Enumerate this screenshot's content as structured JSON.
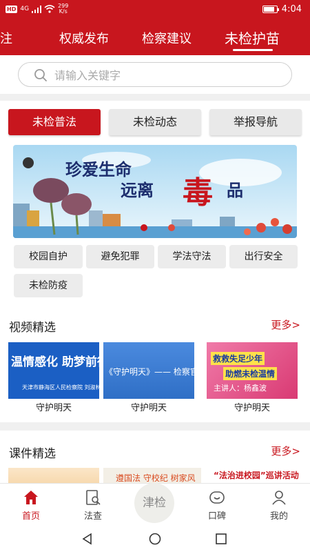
{
  "status_bar": {
    "badge": "HD",
    "net": "4G",
    "speed_value": "299",
    "speed_unit": "K/s",
    "time": "4:04",
    "battery_level": 0.85
  },
  "top_tabs": [
    {
      "label": "关注"
    },
    {
      "label": "权威发布"
    },
    {
      "label": "检察建议"
    },
    {
      "label": "未检护苗",
      "active": true
    }
  ],
  "search": {
    "placeholder": "请输入关键字"
  },
  "sub_tabs": [
    {
      "label": "未检普法",
      "active": true
    },
    {
      "label": "未检动态"
    },
    {
      "label": "举报导航"
    }
  ],
  "banner": {
    "line1": "珍爱生命",
    "line2_a": "远离",
    "line2_b": "毒",
    "line2_c": "品"
  },
  "categories": [
    "校园自护",
    "避免犯罪",
    "学法守法",
    "出行安全",
    "未检防疫"
  ],
  "video_section": {
    "title": "视频精选",
    "more": "更多>",
    "items": [
      {
        "caption": "守护明天",
        "thumb_line1": "温情感化 助梦前行",
        "thumb_line2": "天津市静海区人民检察院 刘淑林"
      },
      {
        "caption": "守护明天",
        "thumb_line1": "《守护明天》—— 检察官讲述"
      },
      {
        "caption": "守护明天",
        "thumb_line1": "救救失足少年",
        "thumb_line2": "助燃未检温情",
        "thumb_line3": "主讲人：杨鑫波"
      }
    ]
  },
  "course_section": {
    "title": "课件精选",
    "more": "更多>",
    "items": [
      {
        "text": ""
      },
      {
        "text": "遵国法 守校纪 树家风"
      },
      {
        "text": "“法治进校园”巡讲活动"
      }
    ]
  },
  "bottom_nav": [
    {
      "label": "首页",
      "icon": "home-icon",
      "active": true
    },
    {
      "label": "法查",
      "icon": "law-search-icon"
    },
    {
      "label": "口碑",
      "icon": "reputation-icon"
    },
    {
      "label": "我的",
      "icon": "profile-icon"
    }
  ],
  "center_logo": "津检",
  "colors": {
    "brand_red": "#c8161e",
    "chip_bg": "#ececec",
    "divider": "#f0f0f0"
  }
}
